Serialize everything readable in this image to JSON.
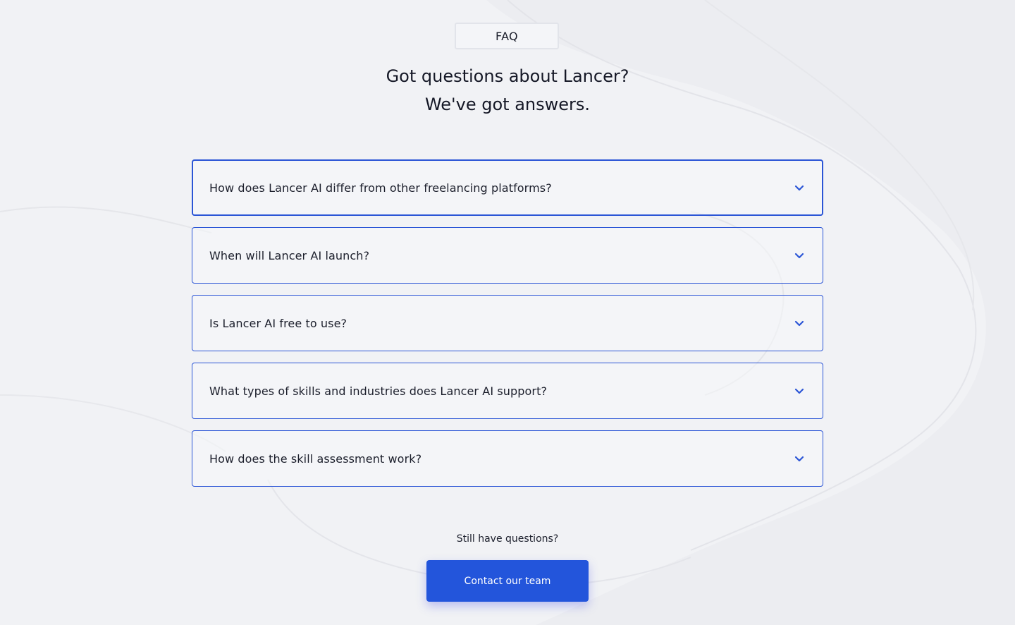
{
  "badge": "FAQ",
  "heading": {
    "line1": "Got questions about Lancer?",
    "line2": "We've got answers."
  },
  "faq": [
    {
      "question": "How does Lancer AI differ from other freelancing platforms?",
      "icon": "chevron-down-icon",
      "active": true
    },
    {
      "question": "When will Lancer AI launch?",
      "icon": "chevron-down-icon"
    },
    {
      "question": "Is Lancer AI free to use?",
      "icon": "chevron-down-icon"
    },
    {
      "question": "What types of skills and industries does Lancer AI support?",
      "icon": "chevron-down-icon"
    },
    {
      "question": "How does the skill assessment work?",
      "icon": "chevron-down-icon"
    }
  ],
  "cta": {
    "prompt": "Still have questions?",
    "button_label": "Contact our team"
  },
  "colors": {
    "accent": "#2355db",
    "border": "#2b55d6",
    "background": "#f1f2f5",
    "text": "#1b1e2b"
  }
}
